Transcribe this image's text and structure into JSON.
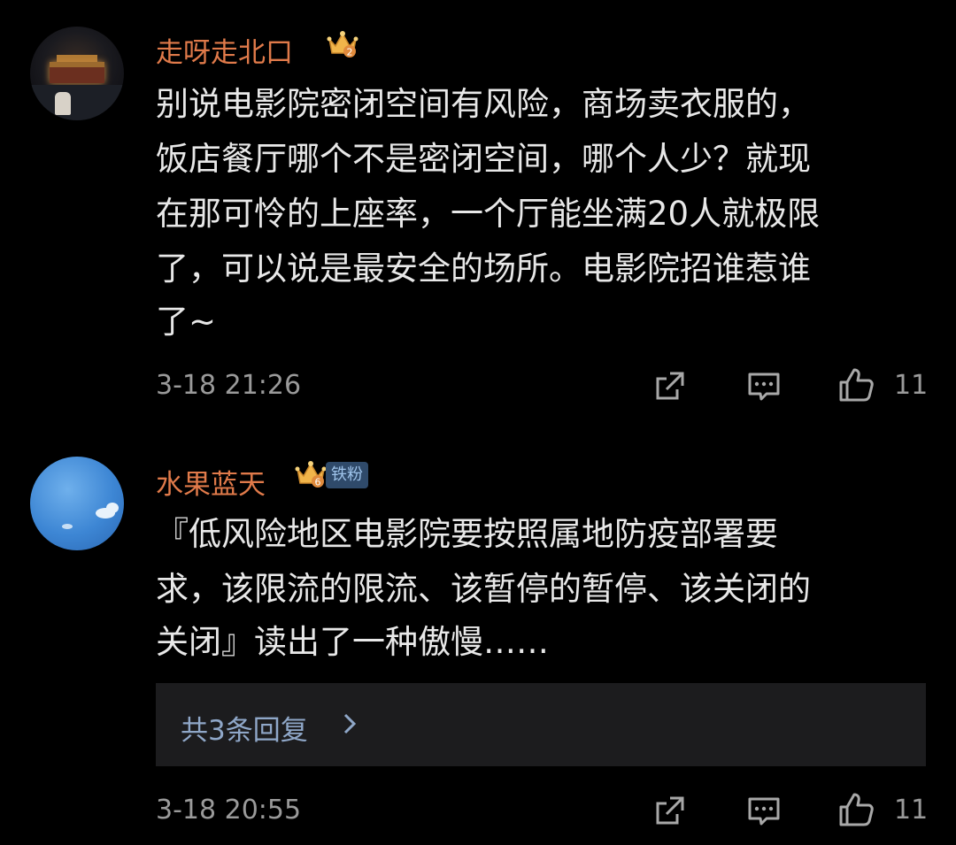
{
  "comments": [
    {
      "username": "走呀走北口",
      "crown_level": "2",
      "lines": [
        "别说电影院密闭空间有风险，商场卖衣服的，",
        "饭店餐厅哪个不是密闭空间，哪个人少？就现",
        "在那可怜的上座率，一个厅能坐满20人就极限",
        "了，可以说是最安全的场所。电影院招谁惹谁",
        "了~"
      ],
      "time": "3-18 21:26",
      "likes": "11"
    },
    {
      "username": "水果蓝天",
      "crown_level": "6",
      "fan_badge": "铁粉",
      "lines": [
        "『低风险地区电影院要按照属地防疫部署要",
        "求，该限流的限流、该暂停的暂停、该关闭的",
        "关闭』读出了一种傲慢……"
      ],
      "replies_label": "共3条回复",
      "time": "3-18 20:55",
      "likes": "11"
    }
  ],
  "icons": {
    "share": "share-icon",
    "comment": "comment-icon",
    "like": "thumbs-up-icon",
    "crown": "crown-icon",
    "chevron": "chevron-right-icon"
  },
  "colors": {
    "background": "#000000",
    "username": "#e07a4a",
    "text": "#e8e8e8",
    "meta": "#9a9a9a",
    "reply_box": "#1c1c1e",
    "reply_link": "#8fa7c8"
  }
}
